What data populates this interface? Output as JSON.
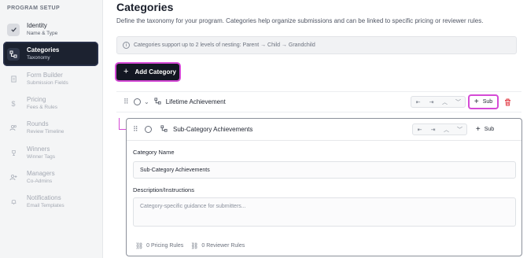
{
  "sidebar": {
    "header": "PROGRAM SETUP",
    "items": [
      {
        "label": "Identity",
        "sublabel": "Name & Type",
        "icon": "check-icon",
        "state": "done"
      },
      {
        "label": "Categories",
        "sublabel": "Taxonomy",
        "icon": "hierarchy-icon",
        "state": "active"
      },
      {
        "label": "Form Builder",
        "sublabel": "Submission Fields",
        "icon": "form-icon",
        "state": "disabled"
      },
      {
        "label": "Pricing",
        "sublabel": "Fees & Rules",
        "icon": "dollar-icon",
        "state": "disabled"
      },
      {
        "label": "Rounds",
        "sublabel": "Review Timeline",
        "icon": "users-icon",
        "state": "disabled"
      },
      {
        "label": "Winners",
        "sublabel": "Winner Tags",
        "icon": "trophy-icon",
        "state": "disabled"
      },
      {
        "label": "Managers",
        "sublabel": "Co-Admins",
        "icon": "user-plus-icon",
        "state": "disabled"
      },
      {
        "label": "Notifications",
        "sublabel": "Email Templates",
        "icon": "bell-icon",
        "state": "disabled"
      }
    ]
  },
  "main": {
    "title": "Categories",
    "description": "Define the taxonomy for your program. Categories help organize submissions and can be linked to specific pricing or reviewer rules.",
    "info": "Categories support up to 2 levels of nesting: Parent → Child → Grandchild",
    "add_button": "Add Category",
    "categories": [
      {
        "name": "Lifetime Achievement",
        "sub_label": "Sub"
      },
      {
        "name": "Sub-Category Achievements",
        "sub_label": "Sub"
      }
    ],
    "editor": {
      "name_label": "Category Name",
      "name_value": "Sub-Category Achievements",
      "desc_label": "Description/Instructions",
      "desc_placeholder": "Category-specific guidance for submitters...",
      "pricing_rules": "0 Pricing Rules",
      "reviewer_rules": "0 Reviewer Rules"
    }
  },
  "colors": {
    "accent": "#d54ad6",
    "active_bg": "#1c2230",
    "danger": "#e0343f"
  }
}
